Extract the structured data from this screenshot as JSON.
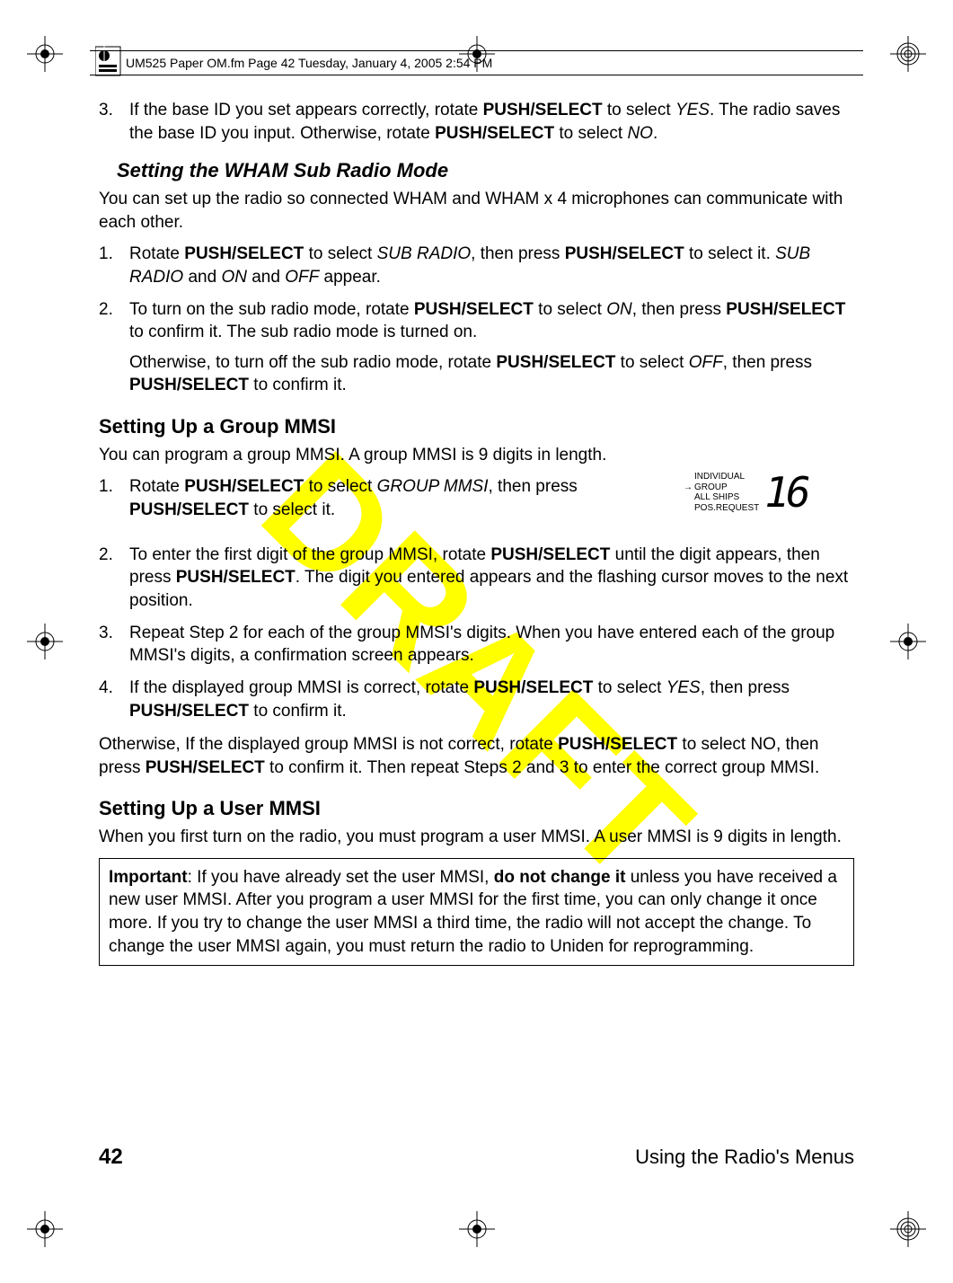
{
  "header": {
    "text": "UM525 Paper OM.fm  Page 42  Tuesday, January 4, 2005  2:54 PM"
  },
  "draft_watermark": "DRAFT",
  "step3_top": "If the base ID you set appears correctly, rotate <b>PUSH/SELECT</b> to select <i>YES</i>. The radio saves the base ID you input. Otherwise, rotate <b>PUSH/SELECT</b> to select <i>NO</i>.",
  "sub_heading": "Setting the WHAM Sub Radio Mode",
  "sub_intro": "You can set up the radio so connected WHAM and WHAM x 4 microphones can communicate with each other.",
  "sub_steps": [
    "Rotate <b>PUSH/SELECT</b> to select <i>SUB RADIO</i>, then press <b>PUSH/SELECT</b> to select it. <i>SUB RADIO</i> and <i>ON</i> and <i>OFF</i> appear.",
    "To turn on the sub radio mode, rotate <b>PUSH/SELECT</b> to select <i>ON</i>, then press <b>PUSH/SELECT</b> to confirm it. The sub radio mode is turned on."
  ],
  "sub_step2_extra": "Otherwise, to turn off the sub radio mode, rotate <b>PUSH/SELECT</b> to select <i>OFF</i>, then press <b>PUSH/SELECT</b> to confirm it.",
  "group_heading": "Setting Up a Group MMSI",
  "group_intro": "You can program a group MMSI. A group MMSI is 9 digits in length.",
  "lcd": {
    "items": [
      "INDIVIDUAL",
      "GROUP",
      "ALL SHIPS",
      "POS.REQUEST"
    ],
    "selected_index": 1,
    "digits": "16"
  },
  "group_steps": [
    "Rotate <b>PUSH/SELECT</b> to select <i>GROUP MMSI</i>, then press <b>PUSH/SELECT</b> to select it.",
    "To enter the first digit of the group MMSI, rotate <b>PUSH/SELECT</b> until the digit appears, then press <b>PUSH/SELECT</b>. The digit you entered appears and the flashing cursor moves to the next position.",
    "Repeat Step 2 for each of the group MMSI's digits. When you have entered each of the group MMSI's digits, a confirmation screen appears.",
    "If the displayed group MMSI is correct, rotate <b>PUSH/SELECT</b> to select <i>YES</i>, then press <b>PUSH/SELECT</b> to confirm it."
  ],
  "group_otherwise": "Otherwise, If the displayed group MMSI is not correct, rotate <b>PUSH/SELECT</b> to select NO, then press <b>PUSH/SELECT</b> to confirm it. Then repeat Steps 2 and 3 to enter the correct group MMSI.",
  "user_heading": "Setting Up a User MMSI",
  "user_intro": "When you first turn on the radio, you must program a user MMSI. A user MMSI is 9 digits in length.",
  "important_box": "<b>Important</b>: If you have already set the user MMSI, <b>do not change it</b> unless you have received a new user MMSI. After you program a user MMSI for the first time, you can only change it once more. If you try to change the user MMSI a third time, the radio will not accept the change. To change the user MMSI again, you must return the radio to Uniden for reprogramming.",
  "footer": {
    "page": "42",
    "title": "Using the Radio's Menus"
  }
}
